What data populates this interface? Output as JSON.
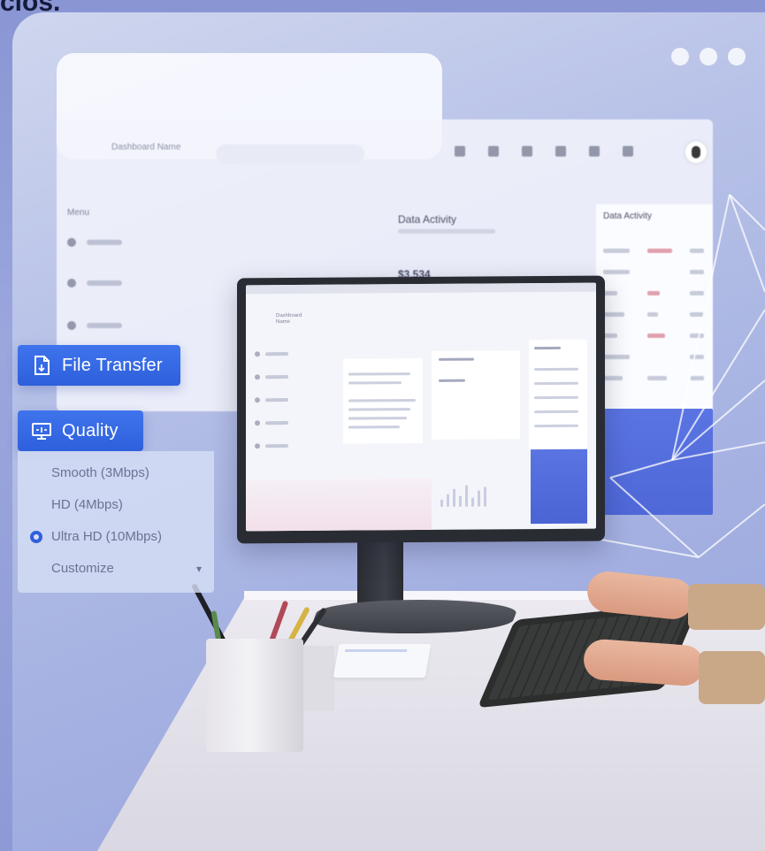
{
  "header_fragment": "cios.",
  "window_controls": {
    "dot_count": 3
  },
  "background_dashboard": {
    "brand": "Dashboard Name",
    "menu_label": "Menu",
    "panel_title": "Data Activity",
    "panel_value": "$3,534",
    "right_panel_title": "Data Activity"
  },
  "file_transfer": {
    "label": "File Transfer",
    "icon": "file-icon"
  },
  "quality": {
    "label": "Quality",
    "icon": "quality-icon",
    "options": [
      {
        "label": "Smooth (3Mbps)",
        "selected": false
      },
      {
        "label": "HD (4Mbps)",
        "selected": false
      },
      {
        "label": "Ultra HD (10Mbps)",
        "selected": true
      },
      {
        "label": "Customize",
        "selected": false,
        "has_chevron": true
      }
    ],
    "chevron": "▾"
  },
  "colors": {
    "accent": "#2f5fdb",
    "background": "#9aa6dc",
    "menu_bg": "#d6def4"
  }
}
